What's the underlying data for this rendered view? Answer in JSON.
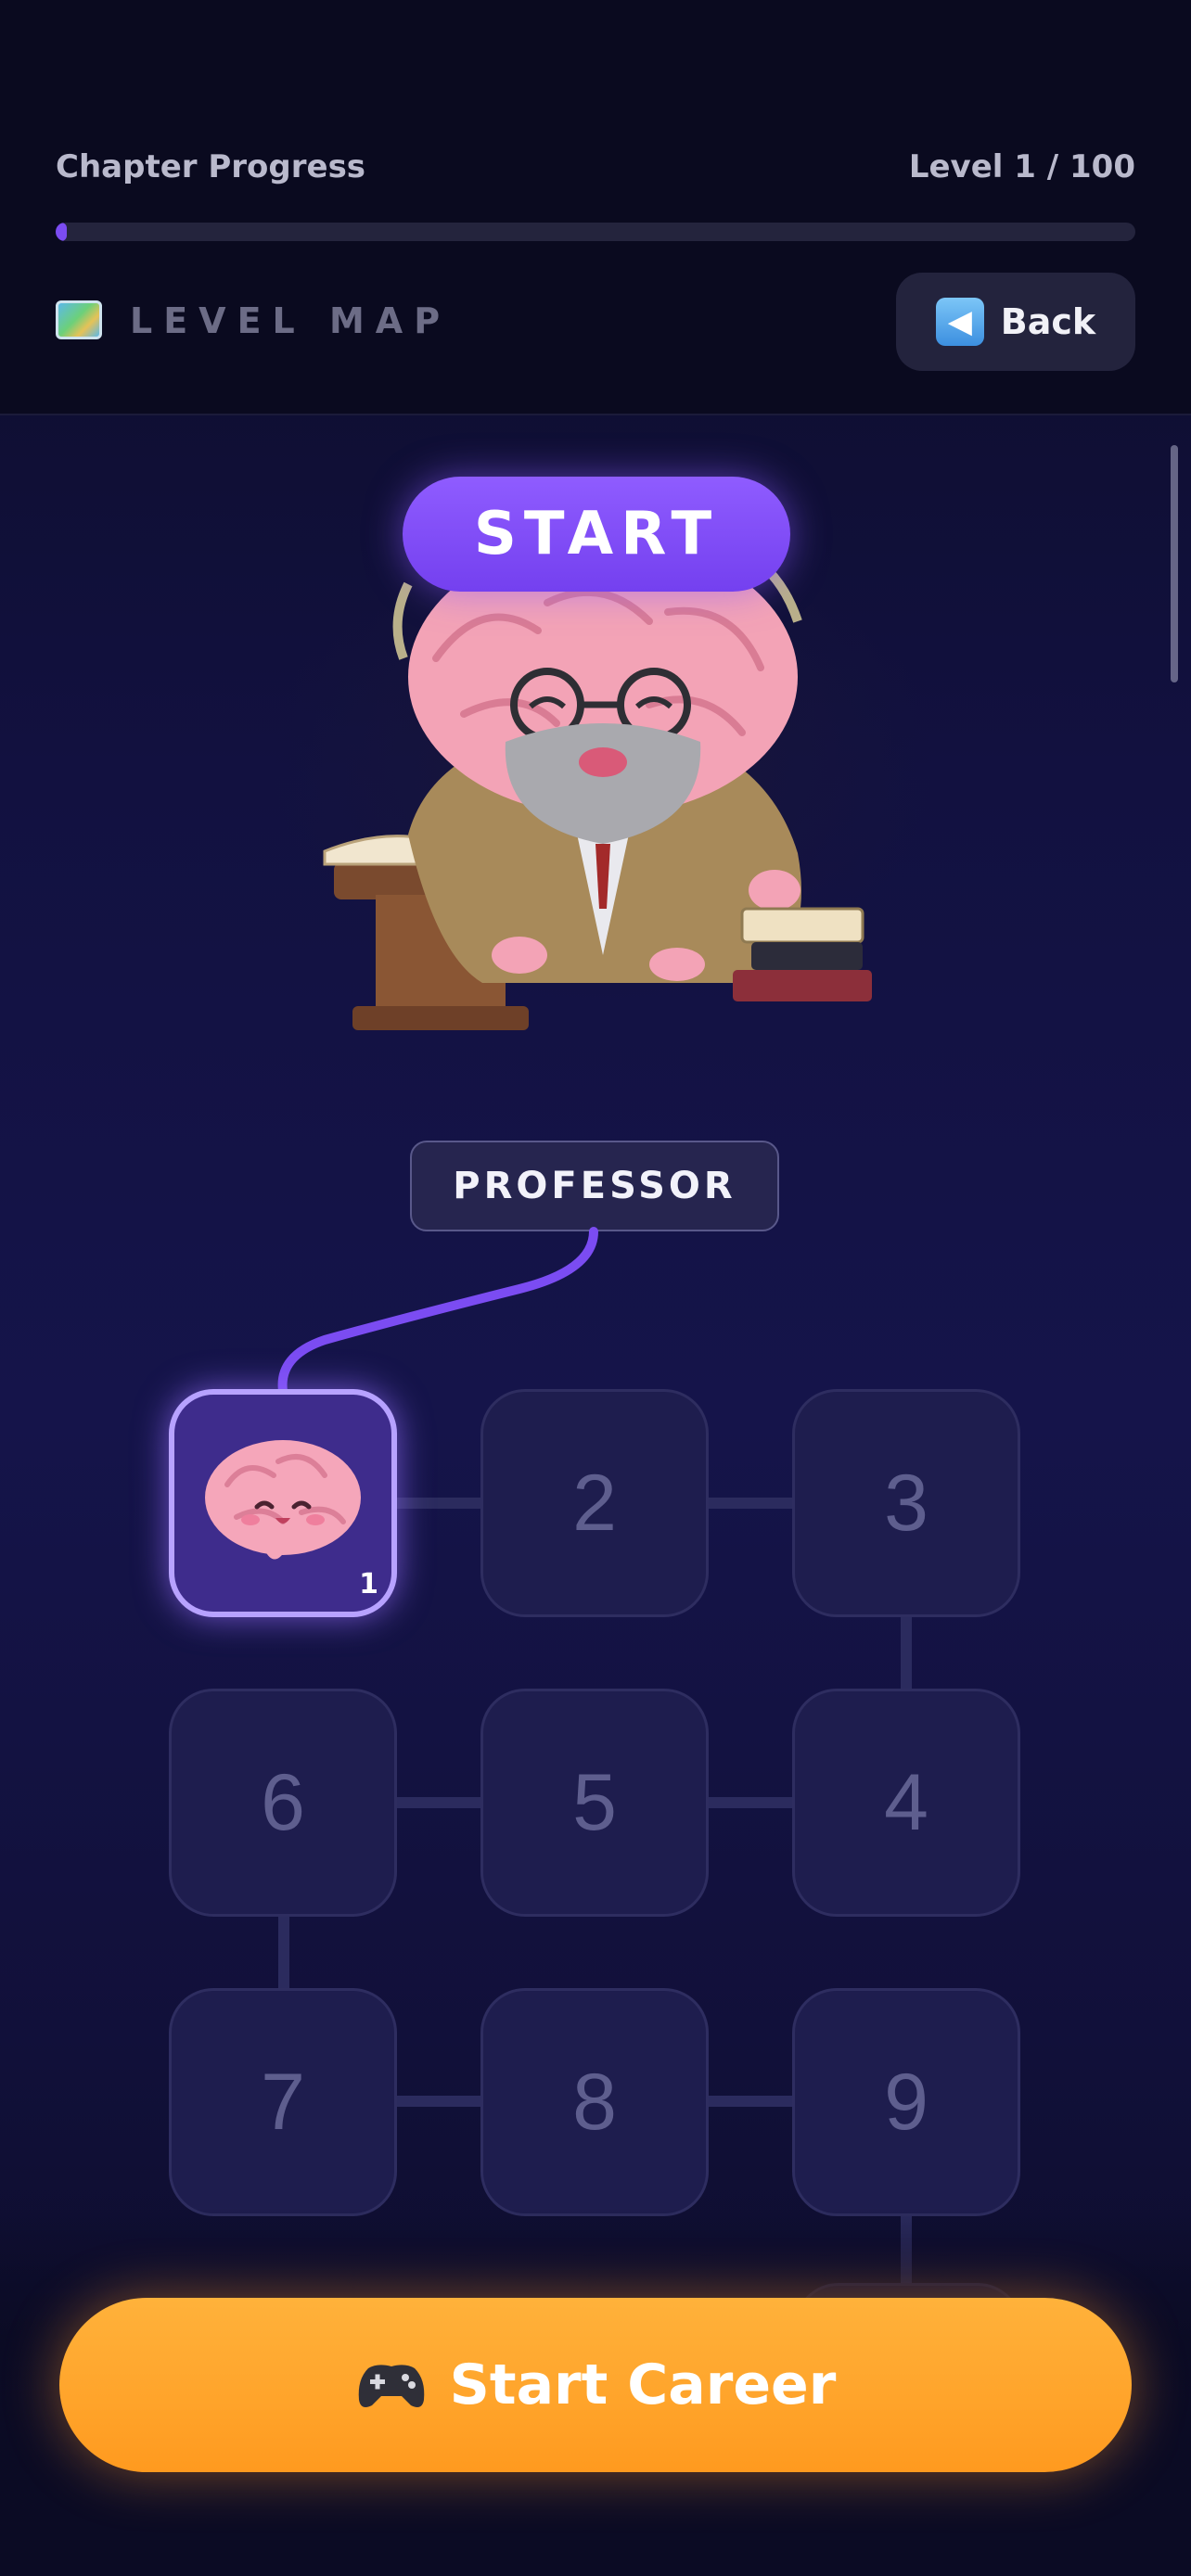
{
  "header": {
    "progress_label": "Chapter Progress",
    "level_count": "Level 1 / 100",
    "progress_fraction": 0.01,
    "map_icon": "map-icon",
    "map_title": "LEVEL MAP",
    "back_icon": "left-arrow-icon",
    "back_label": "Back"
  },
  "hero": {
    "start_label": "START",
    "character_tag": "PROFESSOR"
  },
  "grid": {
    "tiles": [
      {
        "label": "1",
        "active": true,
        "icon": "brain-icon"
      },
      {
        "label": "2"
      },
      {
        "label": "3"
      },
      {
        "label": "4"
      },
      {
        "label": "5"
      },
      {
        "label": "6"
      },
      {
        "label": "7"
      },
      {
        "label": "8"
      },
      {
        "label": "9"
      }
    ]
  },
  "cta": {
    "icon": "gamepad-icon",
    "label": "Start Career"
  },
  "colors": {
    "accent": "#7b4cf2",
    "cta": "#ffa52e",
    "background": "#121140"
  }
}
